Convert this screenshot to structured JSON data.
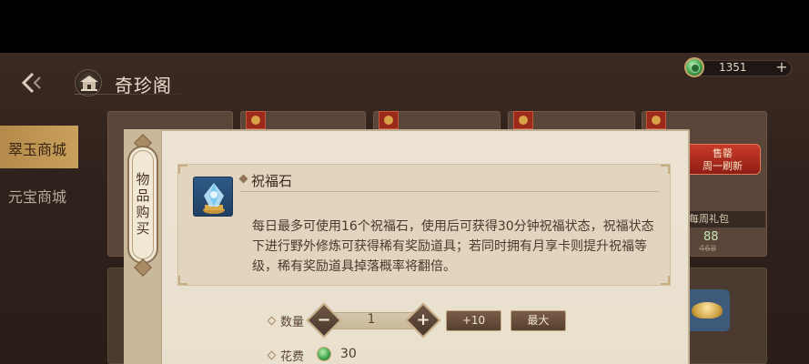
{
  "header": {
    "title": "奇珍阁",
    "back_icon": "back-arrow-icon"
  },
  "currency": {
    "amount": "1351",
    "icon": "jade-coin-icon",
    "add_label": "+"
  },
  "nav": {
    "items": [
      {
        "label": "翠玉商城",
        "active": true
      },
      {
        "label": "元宝商城",
        "active": false
      }
    ]
  },
  "shop": {
    "sold_label_line1": "售罄",
    "sold_label_line2": "周一刷新",
    "gift_label": "每周礼包",
    "price_new": "88",
    "price_old": "468"
  },
  "dialog": {
    "side_title": "物品购买",
    "item": {
      "name": "祝福石",
      "description": "每日最多可使用16个祝福石，使用后可获得30分钟祝福状态，祝福状态下进行野外修炼可获得稀有奖励道具；若同时拥有月享卡则提升祝福等级，稀有奖励道具掉落概率将翻倍。"
    },
    "quantity": {
      "label": "数量",
      "value": "1",
      "plus10_label": "+10",
      "max_label": "最大"
    },
    "fee": {
      "label": "花费",
      "value": "30"
    }
  },
  "colors": {
    "accent_gold": "#c9a15c",
    "jade_green": "#3fa24a",
    "panel_bg": "#ece3d3"
  }
}
